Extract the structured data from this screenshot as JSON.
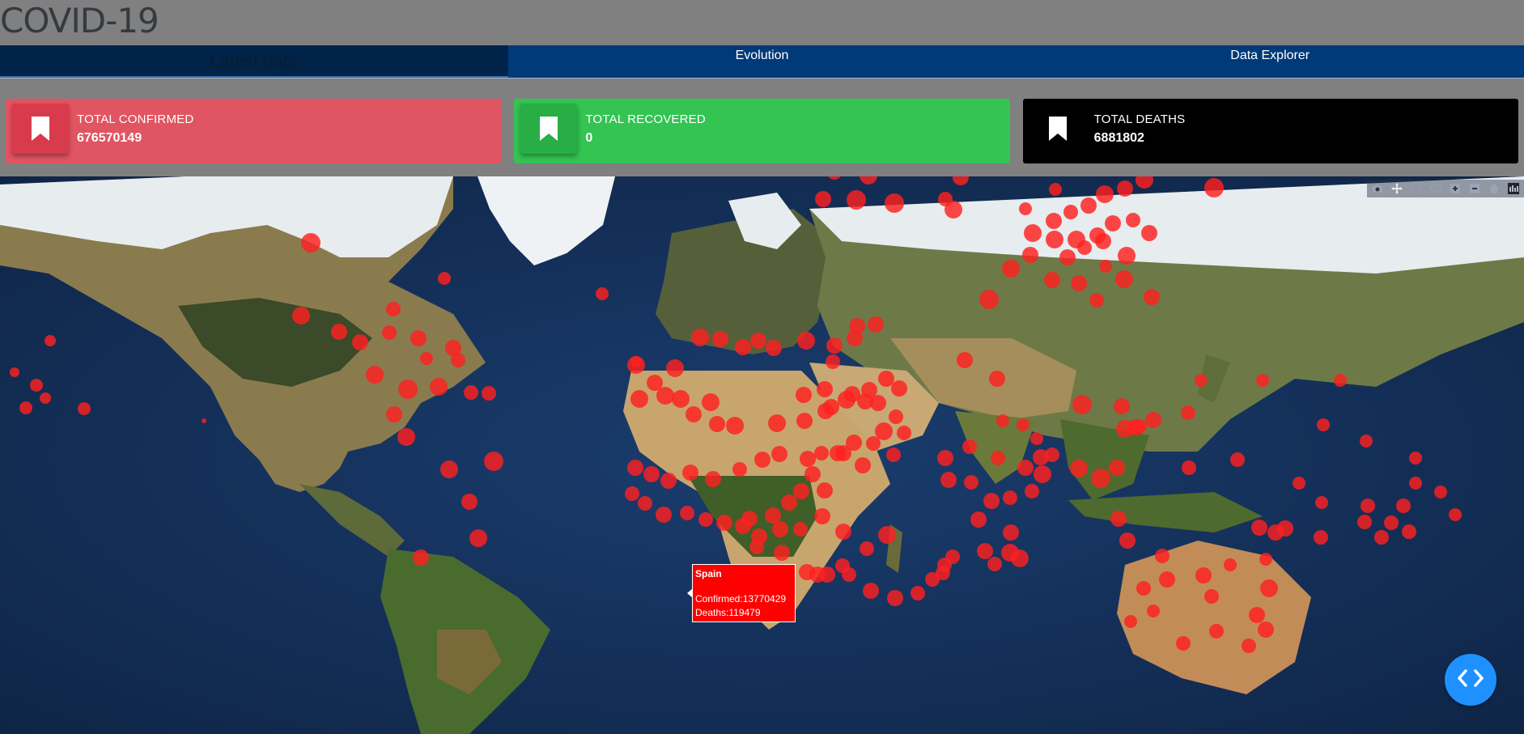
{
  "app": {
    "title": "COVID-19"
  },
  "tabs": [
    {
      "label": "Latest data",
      "active": true
    },
    {
      "label": "Evolution",
      "active": false
    },
    {
      "label": "Data Explorer",
      "active": false
    }
  ],
  "cards": {
    "confirmed": {
      "label": "TOTAL CONFIRMED",
      "value": "676570149",
      "color": "#e15461",
      "icon": "bookmark-icon"
    },
    "recovered": {
      "label": "TOTAL RECOVERED",
      "value": "0",
      "color": "#33c452",
      "icon": "bookmark-icon"
    },
    "deaths": {
      "label": "TOTAL DEATHS",
      "value": "6881802",
      "color": "#000000",
      "icon": "bookmark-icon"
    }
  },
  "map": {
    "marker_color": "#ff2020",
    "toolbar": [
      "camera-icon",
      "pan-icon",
      "box-select-icon",
      "lasso-select-icon",
      "zoom-in-icon",
      "zoom-out-icon",
      "reset-view-icon",
      "plotly-logo-icon"
    ],
    "tooltip": {
      "country": "Spain",
      "confirmed_line": "Confirmed:13770429",
      "deaths_line": "Deaths:119479"
    }
  },
  "fab": {
    "icon": "code-brackets-icon"
  }
}
